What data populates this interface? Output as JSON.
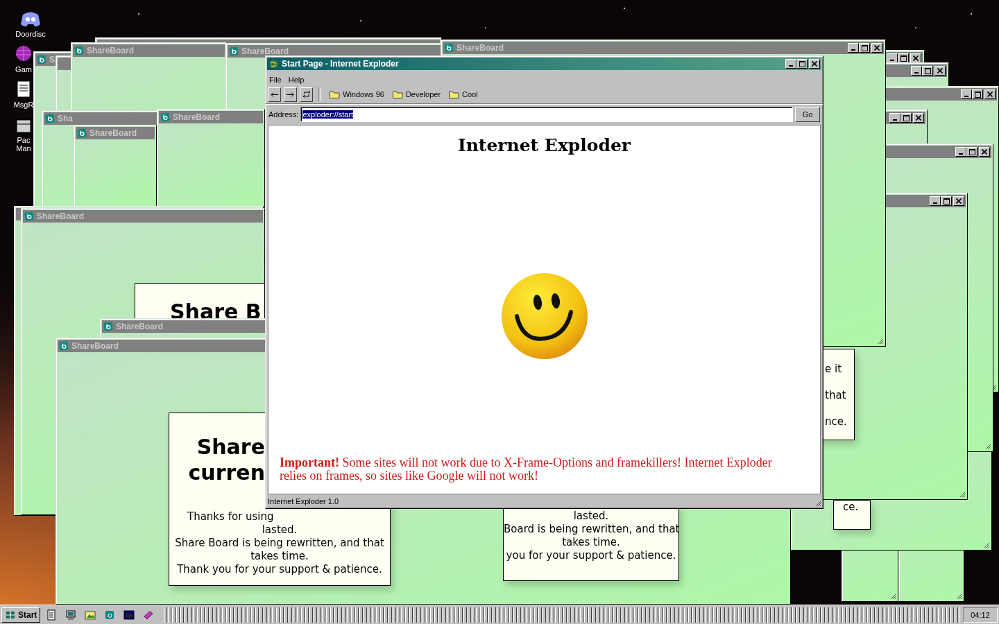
{
  "desktop_icons": [
    {
      "kind": "chat",
      "label": "Doordisc"
    },
    {
      "kind": "game",
      "label": "Gam"
    },
    {
      "kind": "notes",
      "label": "MsgR"
    },
    {
      "kind": "package",
      "label": "Pac Man"
    }
  ],
  "windows": [
    {
      "kind": "window",
      "active": false
    },
    {
      "kind": "window",
      "active": false,
      "title": "S"
    },
    {
      "kind": "window",
      "active": false
    },
    {
      "kind": "window",
      "active": false,
      "title": "ShareBoard"
    },
    {
      "kind": "window",
      "active": false,
      "title": "ShareBoard"
    },
    {
      "kind": "window",
      "active": false,
      "title": "Sha"
    },
    {
      "kind": "window",
      "active": false,
      "title": "ShareBoard"
    },
    {
      "kind": "window",
      "active": false,
      "title": "ShareBoard"
    },
    {
      "kind": "window",
      "active": false
    },
    {
      "kind": "window",
      "active": false,
      "title": "ShareBoard",
      "notices": [
        {
          "heading": [
            "Share B"
          ]
        }
      ]
    },
    {
      "kind": "window",
      "active": false,
      "title": "ShareBoard"
    },
    {
      "kind": "window",
      "active": false,
      "title": "ShareBoard",
      "notices": [
        {
          "heading": [
            "Share",
            "curren"
          ],
          "lines": [
            "Thanks for using",
            "lasted.",
            "Share Board is being rewritten, and that",
            "takes time.",
            "Thank you for your support & patience."
          ]
        },
        {
          "lines": [
            "lasted.",
            "Board is being rewritten, and that",
            "takes time.",
            "you for your support & patience."
          ]
        }
      ]
    },
    {
      "kind": "window"
    },
    {
      "kind": "window"
    },
    {
      "kind": "window",
      "notices": [
        {
          "lines": [
            "ce."
          ]
        }
      ]
    },
    {
      "kind": "window",
      "active": false
    },
    {
      "kind": "window",
      "active": false
    },
    {
      "kind": "window",
      "active": false
    },
    {
      "kind": "window",
      "active": false
    },
    {
      "kind": "window",
      "active": false
    },
    {
      "kind": "window",
      "active": false,
      "notices": [
        {
          "lines": [
            "e it",
            "that",
            "nce."
          ]
        }
      ]
    },
    {
      "kind": "window",
      "active": false,
      "title": "ShareBoard"
    }
  ],
  "browser": {
    "title": "Start Page - Internet Exploder",
    "active": true,
    "menu": [
      "File",
      "Help"
    ],
    "bookmarks": [
      "Windows 96",
      "Developer",
      "Cool"
    ],
    "address": {
      "label": "Address:",
      "value": "exploder://start",
      "selected": true
    },
    "go": "Go",
    "heading": "Internet Exploder",
    "notice": "**Important!** Some sites will not work due to X-Frame-Options and framekillers! Internet Exploder relies on frames, so sites like Google will not work!",
    "status": "Internet Exploder 1.0"
  },
  "taskbar": {
    "start": "Start",
    "clock": "04:12"
  }
}
